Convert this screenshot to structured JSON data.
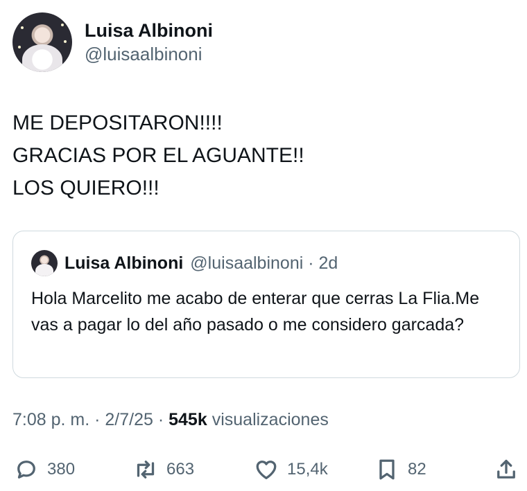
{
  "author": {
    "display_name": "Luisa Albinoni",
    "handle": "@luisaalbinoni"
  },
  "tweet": {
    "lines": [
      "ME DEPOSITARON!!!!",
      "GRACIAS POR EL AGUANTE!!",
      "LOS QUIERO!!!"
    ]
  },
  "quoted_tweet": {
    "display_name": "Luisa Albinoni",
    "handle": "@luisaalbinoni",
    "age": "2d",
    "text": "Hola Marcelito me acabo de enterar que cerras La Flia.Me vas a pagar lo del año pasado o me considero garcada?"
  },
  "meta": {
    "time": "7:08 p. m.",
    "date": "2/7/25",
    "views_count": "545k",
    "views_label": "visualizaciones"
  },
  "actions": {
    "replies": "380",
    "reposts": "663",
    "likes": "15,4k",
    "bookmarks": "82"
  },
  "icons": {
    "reply": "reply-icon",
    "repost": "repost-icon",
    "like": "heart-icon",
    "bookmark": "bookmark-icon",
    "share": "share-icon"
  },
  "colors": {
    "text": "#0f1419",
    "secondary": "#536471",
    "border": "#cfd9de"
  }
}
